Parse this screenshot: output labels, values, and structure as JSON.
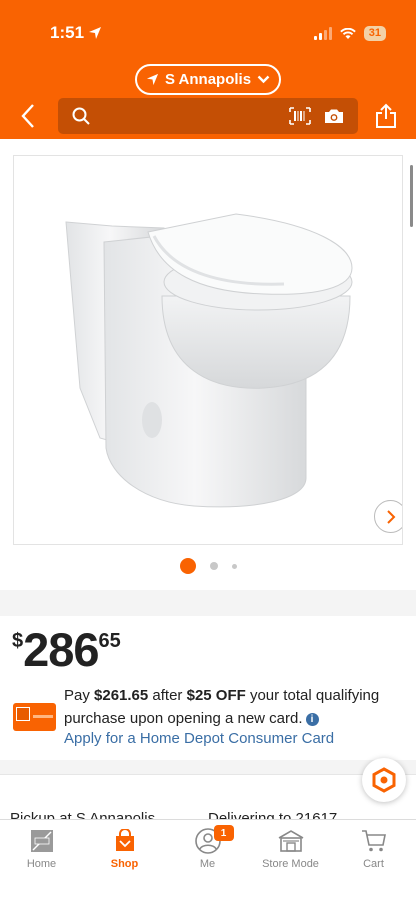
{
  "status_bar": {
    "time": "1:51",
    "battery": "31"
  },
  "header": {
    "location": "S Annapolis",
    "search": {
      "placeholder": ""
    }
  },
  "gallery": {
    "image_count": 3,
    "active_index": 0
  },
  "price": {
    "currency": "$",
    "dollars": "286",
    "cents": "65"
  },
  "promo": {
    "pre": "Pay ",
    "amount": "$261.65",
    "mid": " after ",
    "discount": "$25 OFF",
    "post": " your total qualifying purchase upon opening a new card.",
    "link": "Apply for a Home Depot Consumer Card"
  },
  "fulfillment": {
    "pickup": "Pickup at S Annapolis",
    "delivery": "Delivering to 21617"
  },
  "tabbar": {
    "items": [
      {
        "label": "Home",
        "icon": "home-depot-logo-icon"
      },
      {
        "label": "Shop",
        "icon": "shop-bag-icon"
      },
      {
        "label": "Me",
        "icon": "user-icon",
        "badge": "1"
      },
      {
        "label": "Store Mode",
        "icon": "store-icon"
      },
      {
        "label": "Cart",
        "icon": "cart-icon"
      }
    ]
  },
  "colors": {
    "brand": "#f96302",
    "link": "#3a6ea5"
  }
}
